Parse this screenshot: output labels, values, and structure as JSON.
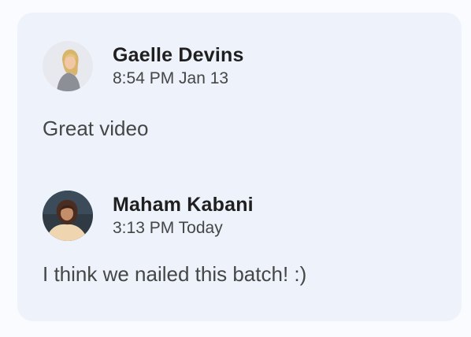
{
  "comments": [
    {
      "author": "Gaelle Devins",
      "timestamp": "8:54 PM Jan 13",
      "text": "Great video",
      "avatar_icon": "avatar-gaelle-devins"
    },
    {
      "author": "Maham Kabani",
      "timestamp": "3:13 PM Today",
      "text": "I think we nailed this batch! :)",
      "avatar_icon": "avatar-maham-kabani"
    }
  ],
  "colors": {
    "page_background": "#fafbfe",
    "card_background": "#eef2fb",
    "author_text": "#1f1f1f",
    "secondary_text": "#444746"
  }
}
